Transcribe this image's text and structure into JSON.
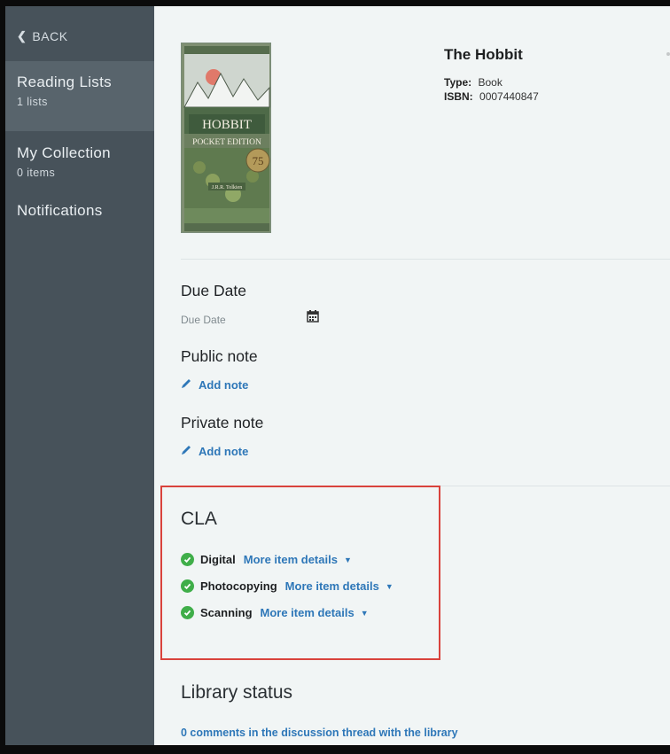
{
  "sidebar": {
    "back_label": "BACK",
    "items": [
      {
        "label": "Reading Lists",
        "sub": "1 lists"
      },
      {
        "label": "My Collection",
        "sub": "0 items"
      },
      {
        "label": "Notifications"
      }
    ]
  },
  "book": {
    "title": "The Hobbit",
    "type_label": "Type:",
    "type_value": "Book",
    "isbn_label": "ISBN:",
    "isbn_value": "0007440847",
    "cover_text": {
      "title_line": "HOBBIT",
      "edition_line": "POCKET EDITION",
      "badge": "75",
      "author": "J.R.R. Tolkien"
    }
  },
  "due_date": {
    "heading": "Due Date",
    "placeholder": "Due Date"
  },
  "public_note": {
    "heading": "Public note",
    "add_label": "Add note"
  },
  "private_note": {
    "heading": "Private note",
    "add_label": "Add note"
  },
  "cla": {
    "heading": "CLA",
    "items": [
      {
        "name": "Digital",
        "more": "More item details"
      },
      {
        "name": "Photocopying",
        "more": "More item details"
      },
      {
        "name": "Scanning",
        "more": "More item details"
      }
    ]
  },
  "library_status": {
    "heading": "Library status",
    "link": "0 comments in the discussion thread with the library"
  },
  "colors": {
    "sidebar_bg": "#47525a",
    "sidebar_active": "#58646c",
    "link": "#2e77b8",
    "check": "#3fae49",
    "highlight_border": "#d9433c"
  }
}
